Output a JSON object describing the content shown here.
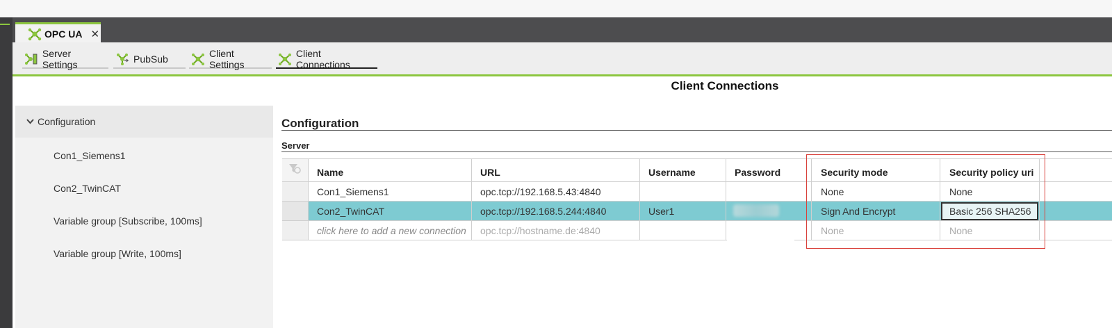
{
  "window_tab": {
    "title": "OPC UA",
    "close_glyph": "✕",
    "icon": "opc-ua-icon"
  },
  "toolbar": {
    "items": [
      {
        "label": "Server Settings",
        "icon": "server-settings-icon",
        "active": false
      },
      {
        "label": "PubSub",
        "icon": "pubsub-icon",
        "active": false
      },
      {
        "label": "Client Settings",
        "icon": "client-settings-icon",
        "active": false
      },
      {
        "label": "Client Connections",
        "icon": "client-connections-icon",
        "active": true
      }
    ]
  },
  "page": {
    "title": "Client Connections"
  },
  "sidebar": {
    "header": "Configuration",
    "items": [
      "Con1_Siemens1",
      "Con2_TwinCAT",
      "Variable group [Subscribe, 100ms]",
      "Variable group [Write, 100ms]"
    ]
  },
  "main": {
    "section_title": "Configuration",
    "subsection_title": "Server",
    "table": {
      "columns": [
        "Name",
        "URL",
        "Username",
        "Password",
        "Security mode",
        "Security policy uri"
      ],
      "rows": [
        {
          "name": "Con1_Siemens1",
          "url": "opc.tcp://192.168.5.43:4840",
          "username": "",
          "password": "",
          "security_mode": "None",
          "security_policy": "None",
          "selected": false
        },
        {
          "name": "Con2_TwinCAT",
          "url": "opc.tcp://192.168.5.244:4840",
          "username": "User1",
          "password": "",
          "security_mode": "Sign And Encrypt",
          "security_policy": "Basic 256 SHA256",
          "selected": true
        }
      ],
      "new_row": {
        "name_placeholder": "click here to add a new connection",
        "url_placeholder": "opc.tcp://hostname.de:4840",
        "security_mode_placeholder": "None",
        "security_policy_placeholder": "None"
      }
    }
  },
  "colors": {
    "accent_green": "#8cc63f",
    "selected_row": "#7ecbd2",
    "highlight_box": "#d9413b"
  }
}
